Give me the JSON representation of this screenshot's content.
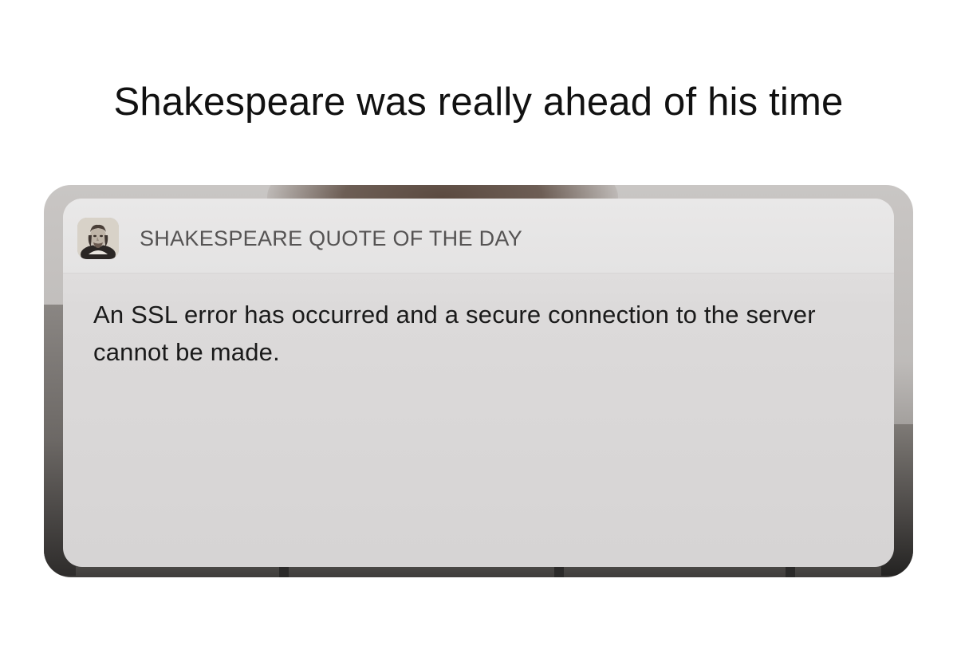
{
  "caption": "Shakespeare was really ahead of his time",
  "notification": {
    "app_name": "SHAKESPEARE QUOTE OF THE DAY",
    "app_icon": "shakespeare-portrait-icon",
    "message": "An SSL error has occurred and a secure connection to the server cannot be made."
  },
  "colors": {
    "caption_text": "#111111",
    "app_name_text": "#555353",
    "message_text": "#1a1a1a",
    "notification_bg": "#dcdada"
  }
}
